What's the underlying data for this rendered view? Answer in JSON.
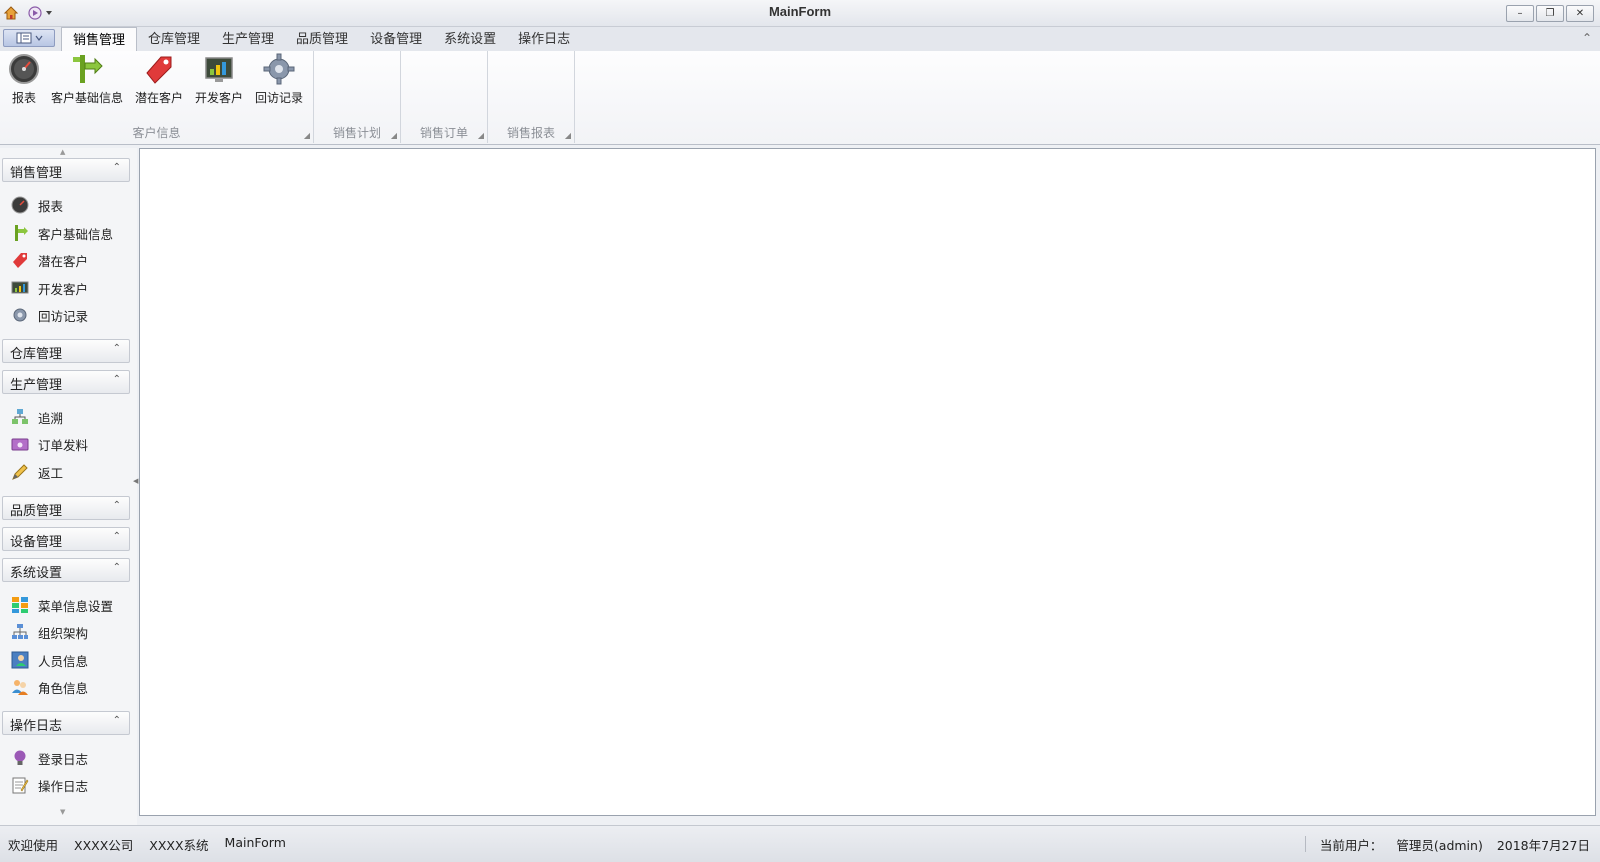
{
  "window": {
    "title": "MainForm",
    "minimize_glyph": "–",
    "restore_glyph": "❐",
    "close_glyph": "✕"
  },
  "ribbon": {
    "tabs": [
      {
        "label": "销售管理",
        "active": true
      },
      {
        "label": "仓库管理",
        "active": false
      },
      {
        "label": "生产管理",
        "active": false
      },
      {
        "label": "品质管理",
        "active": false
      },
      {
        "label": "设备管理",
        "active": false
      },
      {
        "label": "系统设置",
        "active": false
      },
      {
        "label": "操作日志",
        "active": false
      }
    ],
    "groups": [
      {
        "caption": "客户信息",
        "buttons": [
          {
            "label": "报表",
            "icon": "gauge-icon"
          },
          {
            "label": "客户基础信息",
            "icon": "signpost-icon"
          },
          {
            "label": "潜在客户",
            "icon": "tag-icon"
          },
          {
            "label": "开发客户",
            "icon": "chart-monitor-icon"
          },
          {
            "label": "回访记录",
            "icon": "gear-icon"
          }
        ]
      },
      {
        "caption": "销售计划"
      },
      {
        "caption": "销售订单"
      },
      {
        "caption": "销售报表"
      }
    ]
  },
  "navbar": {
    "groups": [
      {
        "title": "销售管理",
        "items": [
          "报表",
          "客户基础信息",
          "潜在客户",
          "开发客户",
          "回访记录"
        ]
      },
      {
        "title": "仓库管理",
        "items": []
      },
      {
        "title": "生产管理",
        "items": [
          "追溯",
          "订单发料",
          "返工"
        ]
      },
      {
        "title": "品质管理",
        "items": []
      },
      {
        "title": "设备管理",
        "items": []
      },
      {
        "title": "系统设置",
        "items": [
          "菜单信息设置",
          "组织架构",
          "人员信息",
          "角色信息"
        ]
      },
      {
        "title": "操作日志",
        "items": [
          "登录日志",
          "操作日志"
        ]
      }
    ]
  },
  "statusbar": {
    "welcome": "欢迎使用",
    "company": "XXXX公司",
    "system": "XXXX系统",
    "form": "MainForm",
    "current_user_label": "当前用户：",
    "current_user": "管理员(admin)",
    "date": "2018年7月27日"
  }
}
